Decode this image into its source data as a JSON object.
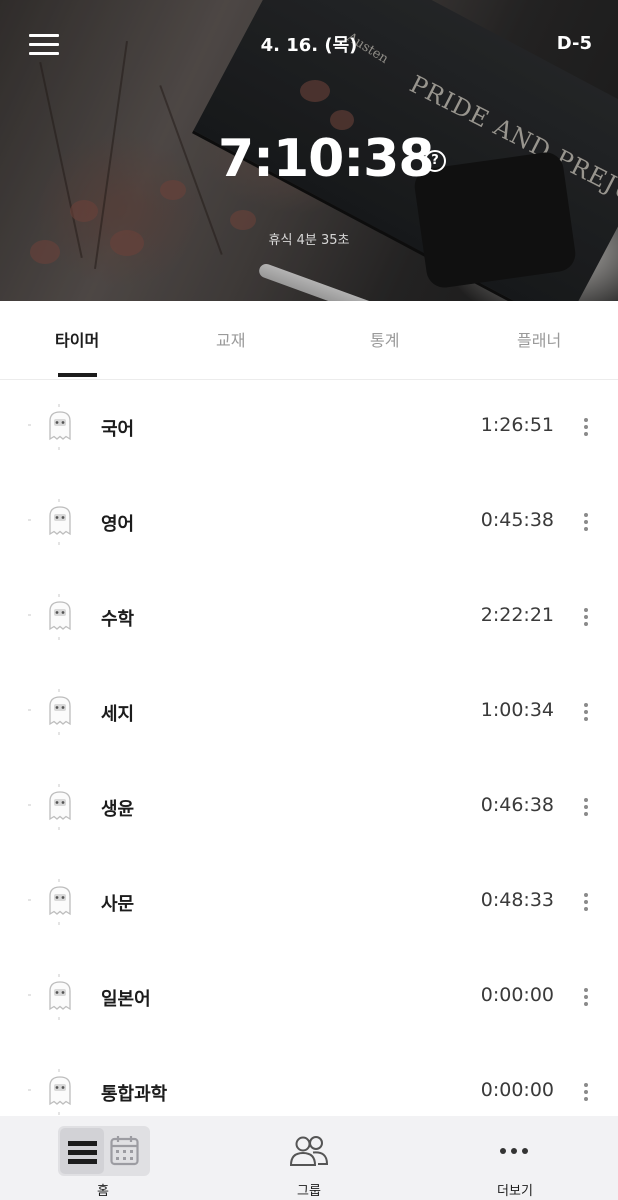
{
  "header": {
    "date": "4. 16. (목)",
    "dday": "D-5",
    "clock": "7:10:38",
    "help_glyph": "?",
    "rest_text": "휴식 4분 35초",
    "background": {
      "book_title": "PRIDE AND PREJUDICE",
      "book_author": "Austen"
    }
  },
  "tabs": [
    {
      "label": "타이머",
      "active": true
    },
    {
      "label": "교재",
      "active": false
    },
    {
      "label": "통계",
      "active": false
    },
    {
      "label": "플래너",
      "active": false
    }
  ],
  "subjects": [
    {
      "name": "국어",
      "time": "1:26:51"
    },
    {
      "name": "영어",
      "time": "0:45:38"
    },
    {
      "name": "수학",
      "time": "2:22:21"
    },
    {
      "name": "세지",
      "time": "1:00:34"
    },
    {
      "name": "생윤",
      "time": "0:46:38"
    },
    {
      "name": "사문",
      "time": "0:48:33"
    },
    {
      "name": "일본어",
      "time": "0:00:00"
    },
    {
      "name": "통합과학",
      "time": "0:00:00"
    }
  ],
  "bottom_nav": {
    "home": "홈",
    "group": "그룹",
    "more": "더보기"
  },
  "colors": {
    "accent": "#1c1c1c",
    "inactive_tab": "#9a9a9a",
    "nav_background": "#f2f2f4"
  },
  "icons": {
    "menu": "hamburger-icon",
    "help": "question-circle-icon",
    "subject": "ghost-icon",
    "row_more": "kebab-icon",
    "home_list": "list-view-icon",
    "home_calendar": "calendar-icon",
    "group": "people-icon",
    "more": "more-dots-icon"
  }
}
